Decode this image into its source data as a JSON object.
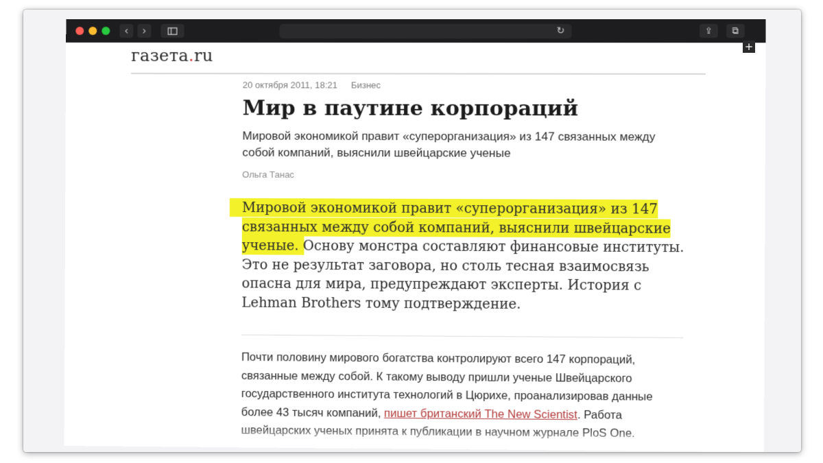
{
  "browser": {
    "icons": {
      "back": "chevron-left-icon",
      "forward": "chevron-right-icon",
      "sidebar": "sidebar-icon",
      "reload": "reload-icon",
      "share": "share-icon",
      "tabs": "tabs-icon",
      "new_tab": "plus-icon"
    },
    "glyphs": {
      "back": "‹",
      "forward": "›",
      "reload": "↻",
      "share": "⇪",
      "tabs": "⧉",
      "plus": "+"
    }
  },
  "site": {
    "logo_main": "газета",
    "logo_dot": ".",
    "logo_tld": "ru"
  },
  "article": {
    "date": "20 октября 2011, 18:21",
    "category": "Бизнес",
    "title": "Мир в паутине корпораций",
    "subtitle": "Мировой экономикой правит «суперорганизация» из 147 связанных между собой компаний, выяснили швейцарские ученые",
    "author": "Ольга Танас",
    "lead_highlighted": "Мировой экономикой правит «суперорганизация» из 147 связанных между собой компаний, выяснили швейцарские ученые.",
    "lead_rest": " Основу монстра составляют финансовые институты. Это не результат заговора, но столь тесная взаимосвязь опасна для мира, предупреждают эксперты. История с Lehman Brothers тому подтверждение.",
    "body_before_link": "Почти половину мирового богатства контролируют всего 147 корпораций, связанные между собой. К такому выводу пришли ученые Швейцарского государственного института технологий в Цюрихе, проанализировав данные более 43 тысяч компаний, ",
    "body_link": "пишет британский The New Scientist",
    "body_after_link": ". Работа швейцарских ученых принята к публикации в научном журнале PloS One."
  },
  "colors": {
    "highlight": "#f3f12a",
    "link": "#b23b3b",
    "toolbar": "#1d1d1f"
  }
}
